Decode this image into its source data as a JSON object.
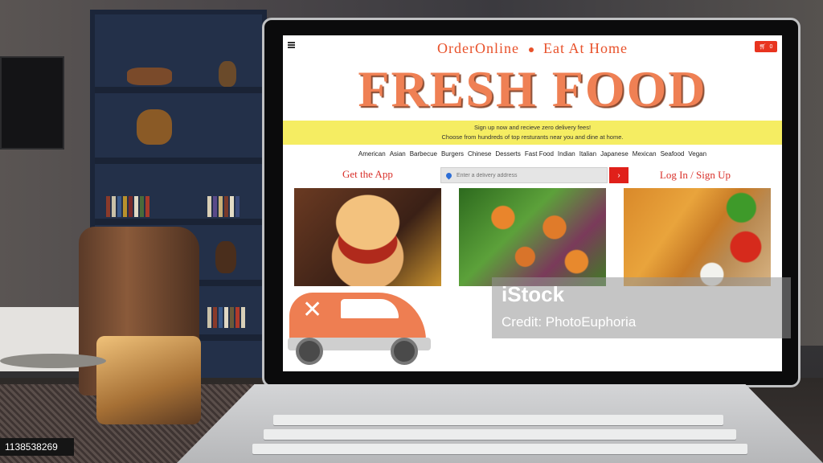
{
  "site": {
    "tagline_left": "OrderOnline",
    "tagline_right": "Eat At Home",
    "brand": "Fresh Food",
    "cart_count": "0"
  },
  "promo": {
    "line1": "Sign up now and recieve zero delivery fees!",
    "line2": "Choose from hundreds of top resturants near you and dine at home."
  },
  "categories": [
    "American",
    "Asian",
    "Barbecue",
    "Burgers",
    "Chinese",
    "Desserts",
    "Fast Food",
    "Indian",
    "Italian",
    "Japanese",
    "Mexican",
    "Seafood",
    "Vegan"
  ],
  "actions": {
    "get_app": "Get the App",
    "address_placeholder": "Enter a delivery address",
    "go_arrow": "›",
    "login": "Log In / Sign Up"
  },
  "icons": {
    "menu": "menu-icon",
    "cart": "cart-icon",
    "pin": "location-pin-icon",
    "car": "delivery-car-icon",
    "cutlery": "fork-knife-icon"
  },
  "colors": {
    "brand_orange": "#ef8054",
    "tagline_orange": "#e8512a",
    "promo_yellow": "#f5ed62",
    "accent_red": "#e0201a"
  },
  "overlay": {
    "watermark_logo": "iStock",
    "watermark_credit": "Credit: PhotoEuphoria",
    "stock_id": "1138538269"
  }
}
